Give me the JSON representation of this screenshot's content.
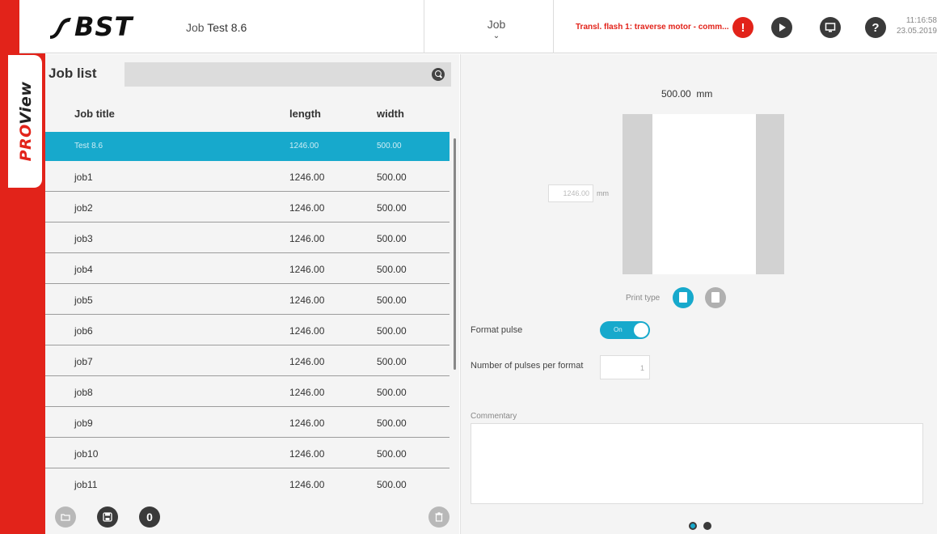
{
  "brand": {
    "proview_pro": "PRO",
    "proview_view": "View",
    "logo_text": "BST"
  },
  "header": {
    "job_prefix": "Job",
    "job_name": "Test 8.6",
    "job_menu_label": "Job",
    "alert_text": "Transl. flash 1: traverse motor - comm...",
    "time": "11:16:58",
    "date": "23.05.2019"
  },
  "colors": {
    "brand_red": "#e2231a",
    "accent_blue": "#17a9cc",
    "dark_icon": "#3a3a3a",
    "disabled_icon": "#b8b8b8"
  },
  "icons": {
    "alert": "exclamation-icon",
    "play": "play-icon",
    "screen": "monitor-icon",
    "help": "help-icon",
    "search": "search-icon"
  },
  "job_list": {
    "title": "Job list",
    "search_placeholder": "",
    "columns": {
      "title": "Job title",
      "length": "length",
      "width": "width"
    },
    "rows": [
      {
        "title": "Test 8.6",
        "length": "1246.00",
        "width": "500.00",
        "selected": true
      },
      {
        "title": "job1",
        "length": "1246.00",
        "width": "500.00"
      },
      {
        "title": "job2",
        "length": "1246.00",
        "width": "500.00"
      },
      {
        "title": "job3",
        "length": "1246.00",
        "width": "500.00"
      },
      {
        "title": "job4",
        "length": "1246.00",
        "width": "500.00"
      },
      {
        "title": "job5",
        "length": "1246.00",
        "width": "500.00"
      },
      {
        "title": "job6",
        "length": "1246.00",
        "width": "500.00"
      },
      {
        "title": "job7",
        "length": "1246.00",
        "width": "500.00"
      },
      {
        "title": "job8",
        "length": "1246.00",
        "width": "500.00"
      },
      {
        "title": "job9",
        "length": "1246.00",
        "width": "500.00"
      },
      {
        "title": "job10",
        "length": "1246.00",
        "width": "500.00"
      },
      {
        "title": "job11",
        "length": "1246.00",
        "width": "500.00"
      }
    ],
    "footer": {
      "counter": "0"
    }
  },
  "details": {
    "width_value": "500.00",
    "width_unit": "mm",
    "length_value": "1246.00",
    "length_unit": "mm",
    "print_type_label": "Print type",
    "format_pulse_label": "Format pulse",
    "format_pulse_state": "On",
    "pulses_label": "Number of pulses per format",
    "pulses_value": "1",
    "commentary_label": "Commentary",
    "commentary_value": ""
  },
  "pager": {
    "pages": 2,
    "active": 0
  }
}
